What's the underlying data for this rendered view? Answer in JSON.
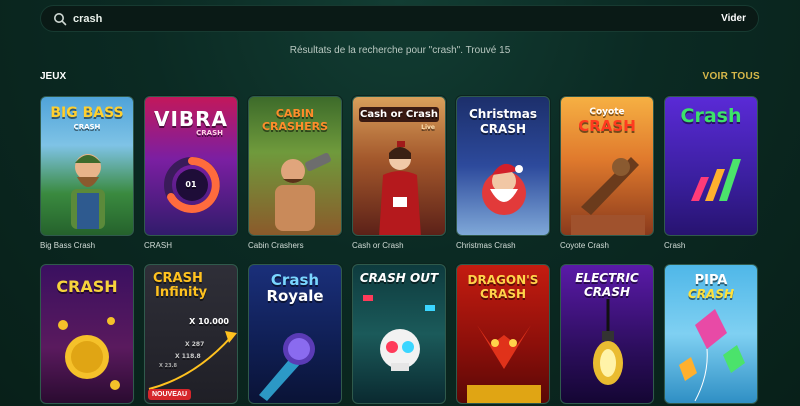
{
  "search": {
    "value": "crash",
    "clear_label": "Vider"
  },
  "results": {
    "text": "Résultats de la recherche pour \"crash\". Trouvé 15"
  },
  "section": {
    "title": "JEUX",
    "view_all": "VOIR TOUS"
  },
  "games": [
    {
      "name": "Big Bass Crash",
      "art": "BIG BASS",
      "art_sub": "CRASH"
    },
    {
      "name": "CRASH",
      "art": "VIBRA",
      "art_sub": "CRASH",
      "counter": "01"
    },
    {
      "name": "Cabin Crashers",
      "art": "CABIN CRASHERS"
    },
    {
      "name": "Cash or Crash",
      "art": "Cash or Crash",
      "art_sub": "Live"
    },
    {
      "name": "Christmas Crash",
      "art": "Christmas",
      "art_sub": "CRASH"
    },
    {
      "name": "Coyote Crash",
      "art": "Coyote",
      "art_sub": "CRASH"
    },
    {
      "name": "Crash",
      "art": "Crash"
    },
    {
      "name": "",
      "art": "CRASH"
    },
    {
      "name": "",
      "art": "CRASH",
      "art_sub": "Infinity",
      "multipliers": [
        "X 10.000",
        "X 287",
        "X 118.8",
        "X 23.8"
      ],
      "badge": "NOUVEAU"
    },
    {
      "name": "",
      "art": "Crash",
      "art_sub": "Royale"
    },
    {
      "name": "",
      "art": "CRASH OUT"
    },
    {
      "name": "",
      "art": "DRAGON'S",
      "art_sub": "CRASH"
    },
    {
      "name": "",
      "art": "ELECTRIC",
      "art_sub": "CRASH"
    },
    {
      "name": "",
      "art": "PIPA",
      "art_sub": "CRASH"
    }
  ]
}
